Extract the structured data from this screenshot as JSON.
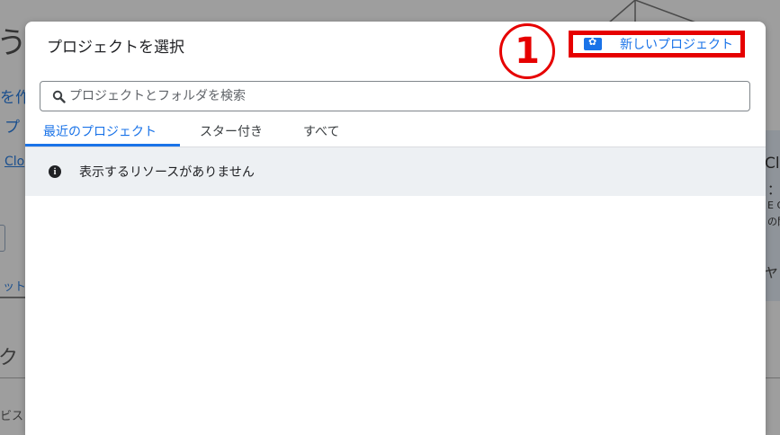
{
  "background": {
    "fragments": [
      "う こ",
      "を作",
      "プ",
      "Clo",
      "ット",
      "ク",
      "ビス",
      "Clo",
      "：詰",
      "E G",
      "の閉",
      "ャ"
    ]
  },
  "dialog": {
    "title": "プロジェクトを選択",
    "new_project_label": "新しいプロジェクト",
    "step_number": "1",
    "search": {
      "placeholder": "プロジェクトとフォルダを検索",
      "value": ""
    },
    "tabs": [
      "最近のプロジェクト",
      "スター付き",
      "すべて"
    ],
    "active_tab": 0,
    "empty_message": "表示するリソースがありません"
  },
  "colors": {
    "accent": "#1a73e8",
    "highlight": "#e60000",
    "banner": "#edf0f3"
  },
  "icons": {
    "new_project": "folder-gear-icon",
    "search": "search-icon",
    "info": "info-icon"
  }
}
